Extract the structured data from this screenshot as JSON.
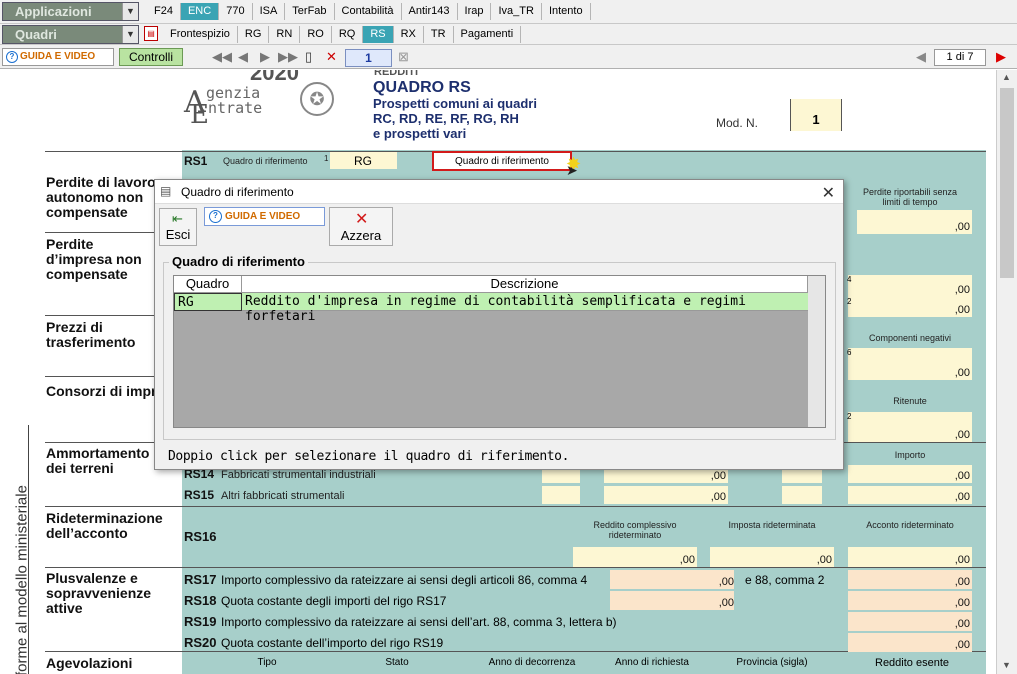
{
  "toolbar1": {
    "combo_label": "Applicazioni",
    "tabs": [
      "F24",
      "ENC",
      "770",
      "ISA",
      "TerFab",
      "Contabilità",
      "Antir143",
      "Irap",
      "Iva_TR",
      "Intento"
    ],
    "active_tab": "ENC"
  },
  "toolbar2": {
    "combo_label": "Quadri",
    "tabs": [
      "Frontespizio",
      "RG",
      "RN",
      "RO",
      "RQ",
      "RS",
      "RX",
      "TR",
      "Pagamenti"
    ],
    "active_tab": "RS"
  },
  "toolbar3": {
    "guida_label": "GUIDA E VIDEO",
    "controlli_label": "Controlli",
    "page_number": "1",
    "page_of": "1 di 7"
  },
  "form": {
    "logo_text_1": "genzia",
    "logo_text_2": "ntrate",
    "logo_a": "A",
    "logo_e": "E",
    "top_cut": "2020",
    "top_cut2": "REDDITI",
    "quadro_title": "QUADRO RS",
    "quadro_sub1": "Prospetti comuni ai quadri",
    "quadro_sub2": "RC, RD, RE, RF, RG, RH",
    "quadro_sub3": "e prospetti vari",
    "mod_label": "Mod. N.",
    "mod_value": "1",
    "rs1_code": "RS1",
    "rs1_label": "Quadro di riferimento",
    "rs1_num": "1",
    "rs1_value": "RG",
    "rs1_button": "Quadro di riferimento",
    "side_text": "Conforme al modello ministeriale",
    "sections": {
      "perdite_lavoro": "Perdite di lavoro autonomo non compensate",
      "perdite_impresa": "Perdite d’impresa non compensate",
      "prezzi": "Prezzi di trasferimento",
      "consorzi": "Consorzi di imprese",
      "ammortamento": "Ammortamento dei terreni",
      "rideterminazione": "Rideterminazione dell’acconto",
      "plusvalenze": "Plusvalenze e sopravvenienze attive",
      "agevolazioni": "Agevolazioni"
    },
    "col_headers": {
      "perdite_riportabili": "Perdite riportabili senza limiti di tempo",
      "componenti_negativi": "Componenti negativi",
      "ritenute": "Ritenute",
      "importo": "Importo",
      "reddito_compl": "Reddito complessivo rideterminato",
      "imposta_rid": "Imposta rideterminata",
      "acconto_rid": "Acconto rideterminato"
    },
    "rows": {
      "rs14_code": "RS14",
      "rs14_label": "Fabbricati strumentali industriali",
      "rs15_code": "RS15",
      "rs15_label": "Altri fabbricati strumentali",
      "rs16_code": "RS16",
      "rs17_code": "RS17",
      "rs17_label": "Importo complessivo da rateizzare ai sensi degli articoli 86, comma 4",
      "rs17_label2": "e 88, comma 2",
      "rs18_code": "RS18",
      "rs18_label": "Quota costante degli importi del rigo RS17",
      "rs19_code": "RS19",
      "rs19_label": "Importo complessivo da rateizzare ai sensi dell’art. 88, comma 3, lettera b)",
      "rs20_code": "RS20",
      "rs20_label": "Quota costante dell’importo del rigo RS19"
    },
    "agevolazioni_headers": [
      "Tipo",
      "Stato",
      "Anno di decorrenza",
      "Anno di richiesta",
      "Provincia (sigla)",
      "Reddito esente"
    ],
    "zero": ",00",
    "field_nums": [
      "1",
      "2",
      "3",
      "4",
      "6"
    ]
  },
  "dialog": {
    "title": "Quadro di riferimento",
    "esci_label": "Esci",
    "guida_label": "GUIDA E VIDEO",
    "azzera_label": "Azzera",
    "group_title": "Quadro di riferimento",
    "columns": [
      "Quadro",
      "Descrizione"
    ],
    "rows": [
      {
        "quadro": "RG",
        "descrizione": "Reddito d'impresa in regime di contabilità semplificata e regimi forfetari"
      }
    ],
    "hint": "Doppio click per selezionare il quadro di riferimento."
  }
}
